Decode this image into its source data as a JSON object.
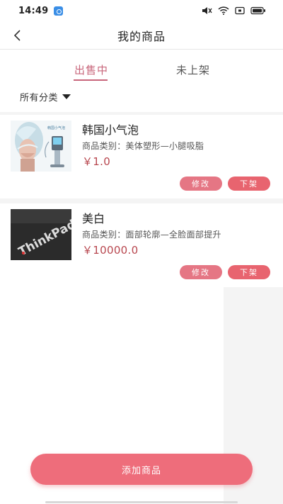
{
  "status_bar": {
    "time": "14:49",
    "icons": [
      "app-notification-icon",
      "mute-icon",
      "wifi-icon",
      "screen-icon",
      "battery-icon"
    ]
  },
  "nav": {
    "back_icon": "chevron-left-icon",
    "title": "我的商品"
  },
  "tabs": [
    {
      "label": "出售中",
      "active": true
    },
    {
      "label": "未上架",
      "active": false
    }
  ],
  "filter": {
    "label": "所有分类",
    "icon": "caret-down-icon"
  },
  "products": [
    {
      "name": "韩国小气泡",
      "category": "商品类别：美体塑形—小腿吸脂",
      "price": "￥1.0",
      "edit_label": "修改",
      "delist_label": "下架",
      "image": "beauty-device-photo",
      "image_caption": "韩国小气泡"
    },
    {
      "name": "美白",
      "category": "商品类别：面部轮廓—全脸面部提升",
      "price": "￥10000.0",
      "edit_label": "修改",
      "delist_label": "下架",
      "image": "thinkpad-logo-photo",
      "image_caption": "ThinkPad"
    }
  ],
  "add_button": {
    "label": "添加商品"
  },
  "colors": {
    "accent": "#c8667b",
    "price": "#b8474f",
    "button": "#ee6d7b"
  }
}
